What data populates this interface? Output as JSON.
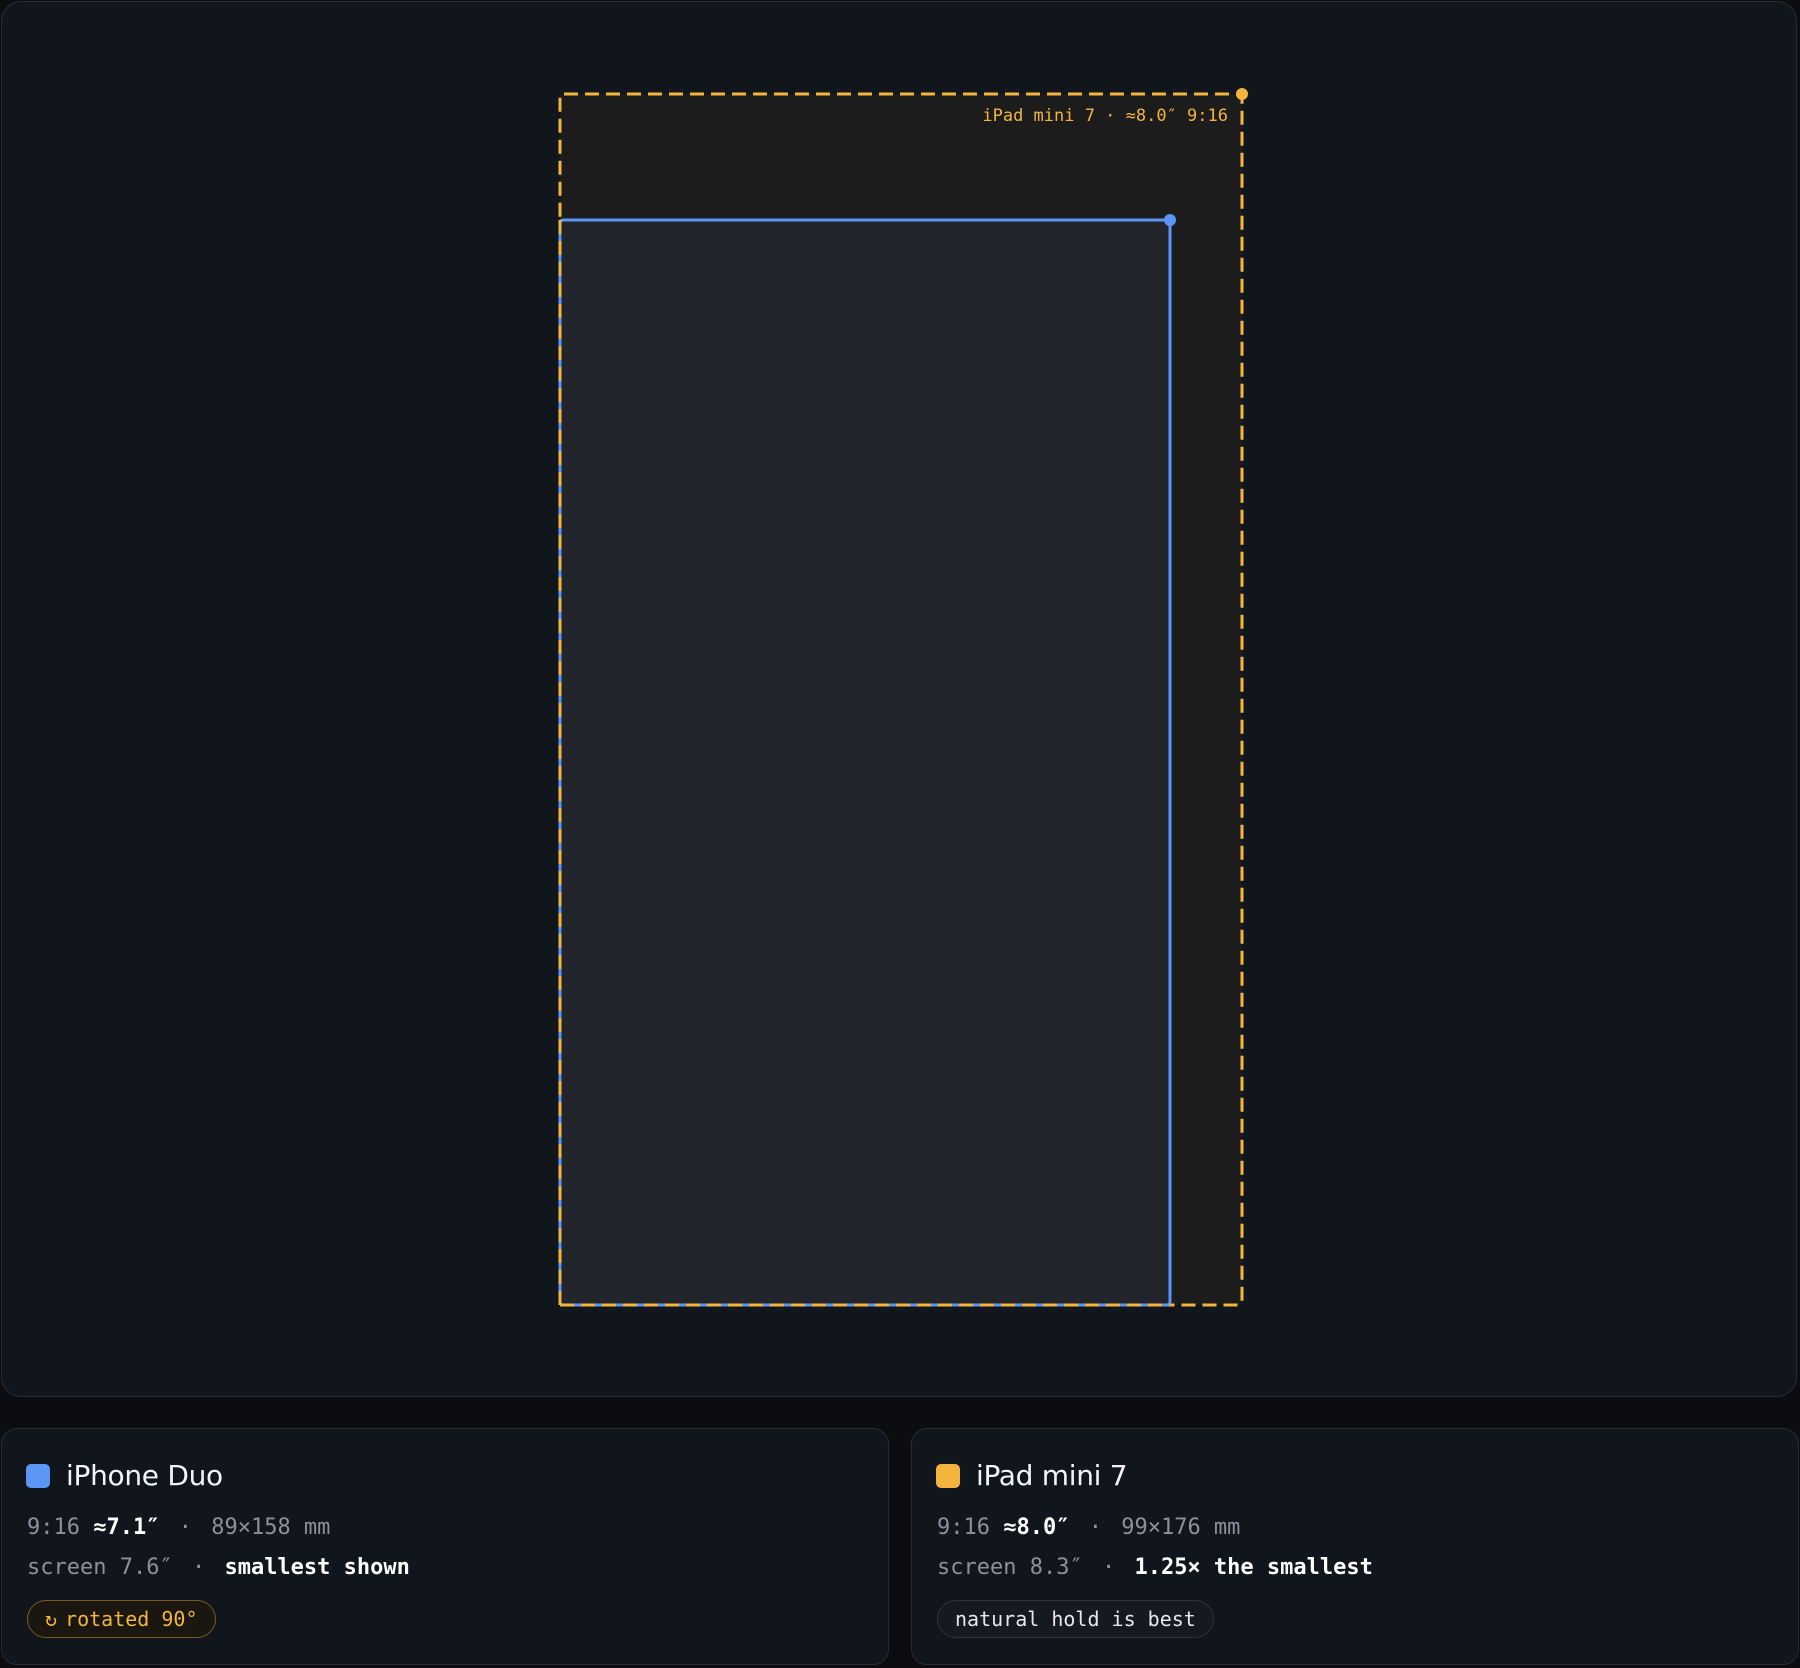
{
  "colors": {
    "background": "#11151c",
    "iphone_duo": "#5b96f7",
    "ipad_mini_7": "#f4b43d"
  },
  "overlay": {
    "outer_label": "iPad mini 7 · ≈8.0″ 9:16"
  },
  "devices": [
    {
      "name": "iPhone Duo",
      "color": "#5b96f7",
      "aspect": "9:16",
      "diag": "≈7.1″",
      "dims": "89×158 mm",
      "screen": "screen 7.6″",
      "note": "smallest shown",
      "badge_icon": "rotate-icon",
      "badge_glyph": "↻",
      "badge": "rotated 90°"
    },
    {
      "name": "iPad mini 7",
      "color": "#f4b43d",
      "aspect": "9:16",
      "diag": "≈8.0″",
      "dims": "99×176 mm",
      "screen": "screen 8.3″",
      "note": "1.25× the smallest",
      "badge": "natural hold is best"
    }
  ],
  "separator": "·"
}
